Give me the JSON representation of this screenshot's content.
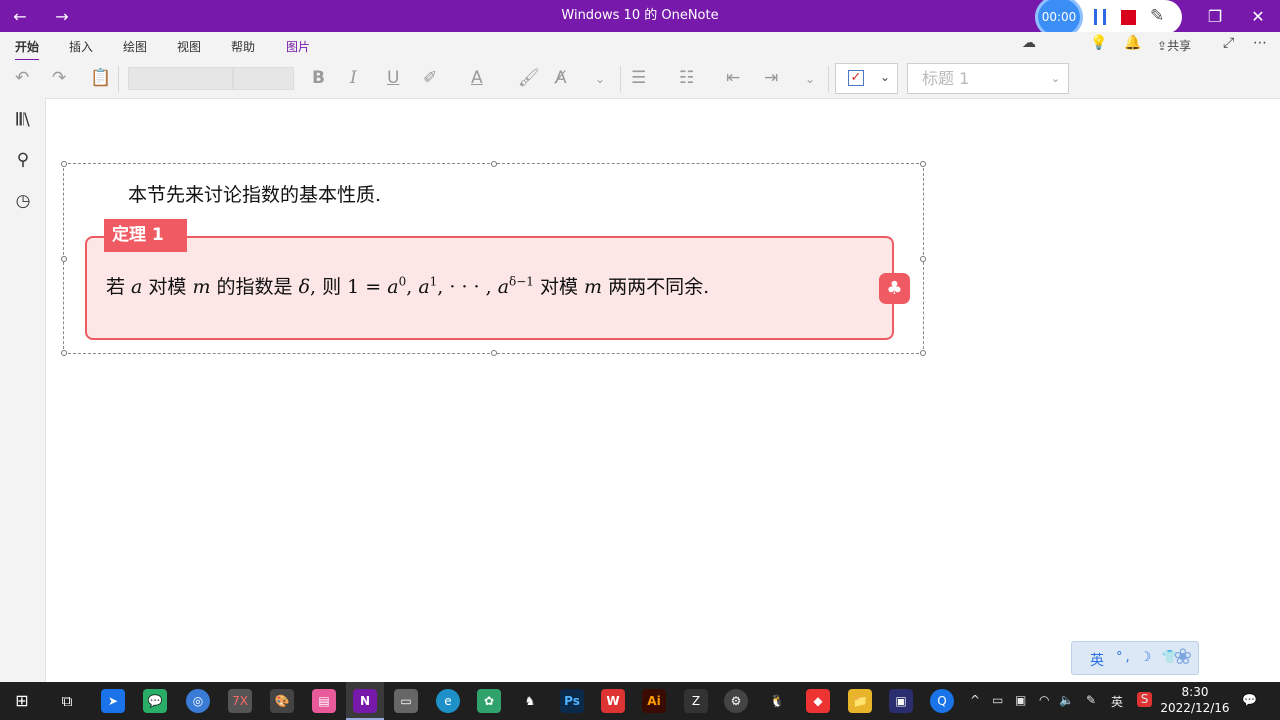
{
  "app": {
    "title": "Windows 10 的 OneNote",
    "back_icon": "arrow-left-icon",
    "forward_icon": "arrow-right-icon",
    "accent": "#7719aa"
  },
  "recorder": {
    "timer": "00:00"
  },
  "ribbon_tabs": [
    "开始",
    "插入",
    "绘图",
    "视图",
    "帮助",
    "图片"
  ],
  "share_label": "共享",
  "style_box": {
    "value": "标题 1"
  },
  "page": {
    "intro": "本节先来讨论指数的基本性质.",
    "theorem_label": "定理 1",
    "theorem": {
      "p1": "若 ",
      "v_a": "a",
      "p2": " 对模 ",
      "v_m": "m",
      "p3": " 的指数是 ",
      "v_delta": "δ",
      "p4": ", 则 1 = ",
      "exp0": "0",
      "exp1": "1",
      "dots": ", · · · , ",
      "exp_d": "δ−1",
      "p5": " 对模 ",
      "p6": " 两两不同余."
    },
    "theorem_color": "#ef5a63"
  },
  "ime": {
    "lang": "英",
    "symbols": "°, ☽ 👕"
  },
  "clock": {
    "time": "8:30",
    "date": "2022/12/16"
  },
  "tray": {
    "ime_lang": "英"
  }
}
